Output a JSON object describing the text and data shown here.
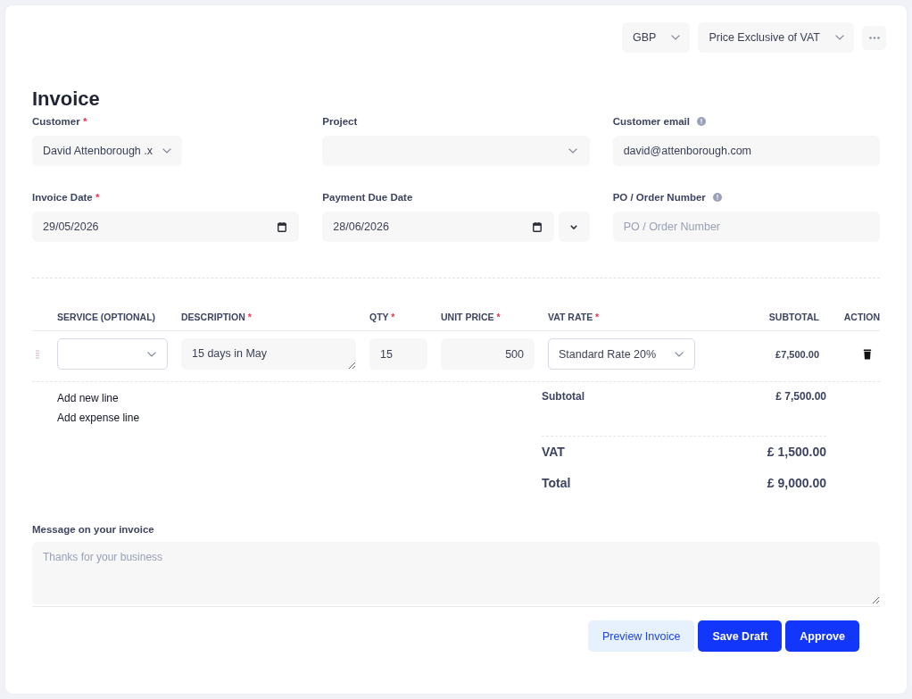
{
  "header_controls": [
    {
      "kind": "select",
      "value": "GBP"
    },
    {
      "kind": "select",
      "value": "Price Exclusive of VAT"
    },
    {
      "kind": "more"
    }
  ],
  "title": "Invoice",
  "fields": [
    {
      "kind": "select",
      "label": "Customer",
      "required_mark": "*",
      "info_icon": false,
      "value": "David Attenborough .x"
    },
    {
      "kind": "select",
      "label": "Project",
      "info_icon": false
    },
    {
      "kind": "text",
      "label": "Customer email",
      "info_icon": true,
      "value": "david@attenborough.com"
    },
    {
      "kind": "date",
      "label": "Invoice Date",
      "required_mark": "*",
      "info_icon": false,
      "value": "29/05/2026",
      "menu_button": false
    },
    {
      "kind": "date",
      "label": "Payment Due Date",
      "info_icon": false,
      "value": "28/06/2026",
      "menu_button": true
    },
    {
      "kind": "text",
      "label": "PO / Order Number",
      "info_icon": true,
      "placeholder": "PO / Order Number"
    }
  ],
  "line_items": {
    "columns": [
      {
        "label": "SERVICE (OPTIONAL)"
      },
      {
        "label": "DESCRIPTION",
        "required_mark": "*"
      },
      {
        "label": "QTY",
        "required_mark": "*"
      },
      {
        "label": "UNIT PRICE",
        "required_mark": "*"
      },
      {
        "label": "VAT RATE",
        "required_mark": "*"
      },
      {
        "label": "SUBTOTAL"
      },
      {
        "label": "ACTION"
      }
    ],
    "rows": [
      {
        "description": "15 days in May",
        "qty": "15",
        "unit_price": "500",
        "vat_rate": "Standard Rate 20%",
        "subtotal": "£7,500.00"
      }
    ]
  },
  "add_links": [
    "Add new line",
    "Add expense line"
  ],
  "totals": [
    {
      "kind": "minor",
      "label": "Subtotal",
      "value": "£ 7,500.00"
    },
    {
      "kind": "major",
      "label": "VAT",
      "value": "£ 1,500.00"
    },
    {
      "kind": "major",
      "label": "Total",
      "value": "£ 9,000.00"
    }
  ],
  "message": {
    "label": "Message on your invoice",
    "placeholder": "Thanks for your business"
  },
  "buttons": [
    {
      "kind": "secondary",
      "label": "Preview Invoice"
    },
    {
      "kind": "primary",
      "label": "Save Draft"
    },
    {
      "kind": "primary",
      "label": "Approve"
    }
  ]
}
